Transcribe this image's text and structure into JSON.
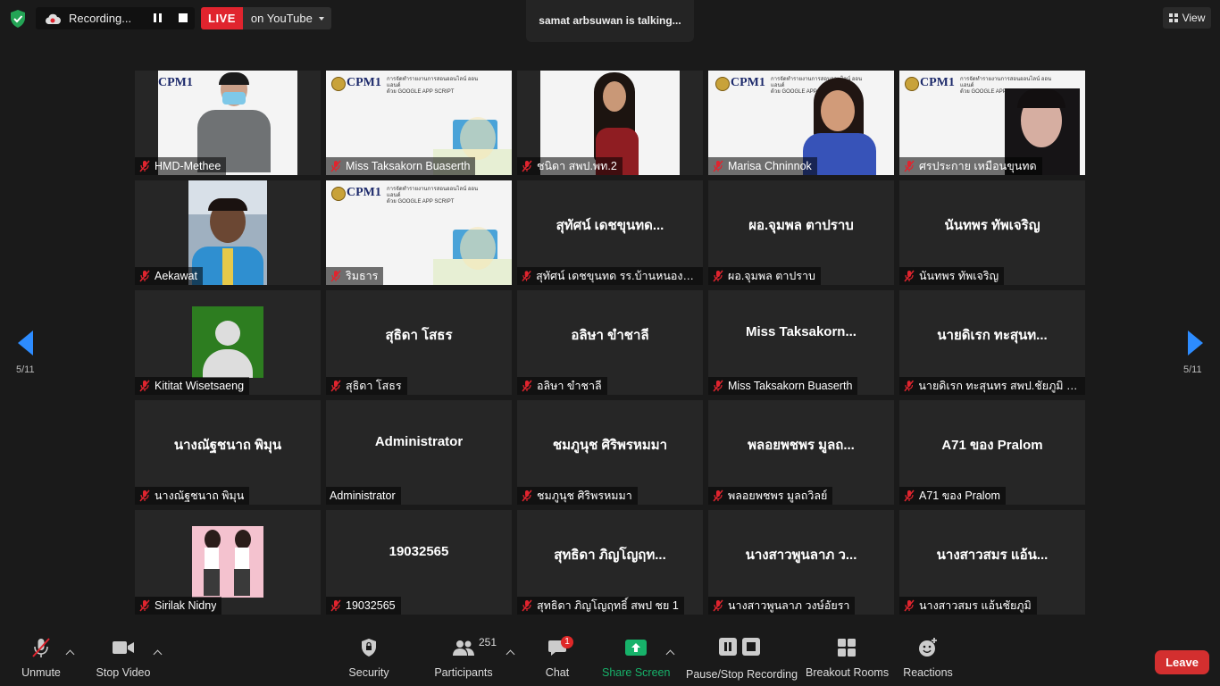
{
  "topbar": {
    "recording_label": "Recording...",
    "live_badge": "LIVE",
    "live_destination": "on YouTube",
    "talking_notice": "samat arbsuwan is talking...",
    "view_label": "View"
  },
  "navigation": {
    "page_left": "5/11",
    "page_right": "5/11"
  },
  "tiles": [
    {
      "name": "HMD-Methee",
      "kind": "video"
    },
    {
      "name": "Miss Taksakorn  Buaserth",
      "kind": "slide"
    },
    {
      "name": "ชนิดา สพป.พท.2",
      "kind": "video"
    },
    {
      "name": "Marisa Chninnok",
      "kind": "video"
    },
    {
      "name": "ศรประกาย เหมือนขุนทด",
      "kind": "video"
    },
    {
      "name": "Aekawat",
      "kind": "video"
    },
    {
      "name": "ริมธาร",
      "kind": "slide"
    },
    {
      "name": "สุทัศน์ เดชขุนทด รร.บ้านหนองหญ้...",
      "display": "สุทัศน์ เดชขุนทด...",
      "kind": "text"
    },
    {
      "name": "ผอ.จุมพล  ตาปราบ",
      "display": "ผอ.จุมพล  ตาปราบ",
      "kind": "text"
    },
    {
      "name": "นันทพร ทัพเจริญ",
      "display": "นันทพร ทัพเจริญ",
      "kind": "text"
    },
    {
      "name": "Kititat Wisetsaeng",
      "kind": "avatar"
    },
    {
      "name": "สุธิดา  โสธร",
      "display": "สุธิดา  โสธร",
      "kind": "text"
    },
    {
      "name": "อลิษา ขำชาลี",
      "display": "อลิษา ขำชาลี",
      "kind": "text"
    },
    {
      "name": "Miss Taksakorn Buaserth",
      "display": "Miss  Taksakorn...",
      "kind": "text"
    },
    {
      "name": "นายดิเรก ทะสุนทร   สพป.ชัยภูมิ เข...",
      "display": "นายดิเรก ทะสุนท...",
      "kind": "text"
    },
    {
      "name": "นางณัฐชนาถ  พิมุน",
      "display": "นางณัฐชนาถ  พิมุน",
      "kind": "text"
    },
    {
      "name": "Administrator",
      "display": "Administrator",
      "kind": "text",
      "no_mic": true
    },
    {
      "name": "ชมภูนุช ศิริพรหมมา",
      "display": "ชมภูนุช ศิริพรหมมา",
      "kind": "text"
    },
    {
      "name": "พลอยพชพร มูลถวิลย์",
      "display": "พลอยพชพร มูลถ...",
      "kind": "text"
    },
    {
      "name": "A71 ของ Pralom",
      "display": "A71 ของ Pralom",
      "kind": "text"
    },
    {
      "name": "Sirilak Nidny",
      "kind": "photo"
    },
    {
      "name": "19032565",
      "display": "19032565",
      "kind": "text"
    },
    {
      "name": "สุทธิดา ภิญโญฤทธิ์ สพป ชย 1",
      "display": "สุทธิดา ภิญโญฤท...",
      "kind": "text"
    },
    {
      "name": "นางสาวพูนลาภ วงษ์อัยรา",
      "display": "นางสาวพูนลาภ ว...",
      "kind": "text"
    },
    {
      "name": "นางสาวสมร แอ้นชัยภูมิ",
      "display": "นางสาวสมร แอ้น...",
      "kind": "text"
    }
  ],
  "slide": {
    "logo_text": "CPM1",
    "subtitle_line1": "การจัดทำรายงานการสอนออนไลน์ ออนแอนด์",
    "subtitle_line2": "ด้วย GOOGLE APP SCRIPT"
  },
  "toolbar": {
    "unmute": "Unmute",
    "stop_video": "Stop Video",
    "security": "Security",
    "participants": "Participants",
    "participants_count": "251",
    "chat": "Chat",
    "chat_badge": "1",
    "share_screen": "Share Screen",
    "pause_stop_recording": "Pause/Stop Recording",
    "breakout_rooms": "Breakout Rooms",
    "reactions": "Reactions",
    "leave": "Leave"
  },
  "colors": {
    "accent_blue": "#2d8cff",
    "live_red": "#e0242e",
    "leave_red": "#d32f2f",
    "share_green": "#17b26a",
    "mic_muted_red": "#e0242e"
  }
}
